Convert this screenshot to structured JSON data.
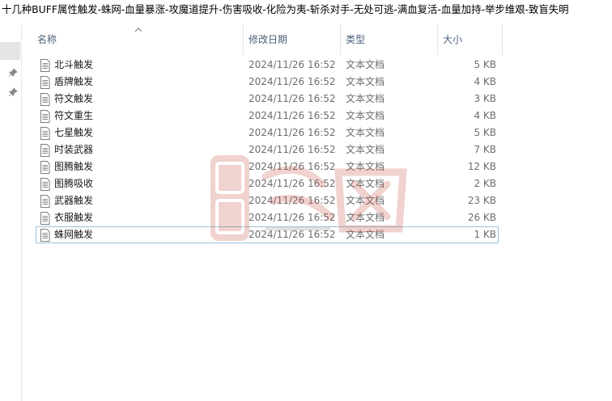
{
  "window": {
    "title": "十几种BUFF属性触发-蛛网-血量暴涨-攻魔道提升-伤害吸收-化险为夷-斩杀对手-无处可逃-满血复活-血量加持-举步维艰-致盲失明"
  },
  "columns": {
    "name": "名称",
    "date": "修改日期",
    "type": "类型",
    "size": "大小"
  },
  "files": [
    {
      "name": "北斗触发",
      "date": "2024/11/26 16:52",
      "type": "文本文档",
      "size": "5 KB"
    },
    {
      "name": "盾牌触发",
      "date": "2024/11/26 16:52",
      "type": "文本文档",
      "size": "4 KB"
    },
    {
      "name": "符文触发",
      "date": "2024/11/26 16:52",
      "type": "文本文档",
      "size": "3 KB"
    },
    {
      "name": "符文重生",
      "date": "2024/11/26 16:52",
      "type": "文本文档",
      "size": "4 KB"
    },
    {
      "name": "七星触发",
      "date": "2024/11/26 16:52",
      "type": "文本文档",
      "size": "5 KB"
    },
    {
      "name": "时装武器",
      "date": "2024/11/26 16:52",
      "type": "文本文档",
      "size": "7 KB"
    },
    {
      "name": "图腾触发",
      "date": "2024/11/26 16:52",
      "type": "文本文档",
      "size": "12 KB"
    },
    {
      "name": "图腾吸收",
      "date": "2024/11/26 16:52",
      "type": "文本文档",
      "size": "2 KB"
    },
    {
      "name": "武器触发",
      "date": "2024/11/26 16:52",
      "type": "文本文档",
      "size": "23 KB"
    },
    {
      "name": "衣服触发",
      "date": "2024/11/26 16:52",
      "type": "文本文档",
      "size": "26 KB"
    },
    {
      "name": "蛛网触发",
      "date": "2024/11/26 16:52",
      "type": "文本文档",
      "size": "1 KB"
    }
  ],
  "icons": {
    "file": "text-document-icon",
    "pin": "pin-icon",
    "sort": "sort-ascending-icon"
  },
  "colors": {
    "header_text": "#4c607a",
    "focus_border": "#99c2d9",
    "secondary_text": "#6d6d6d",
    "watermark": "#c0392b"
  }
}
